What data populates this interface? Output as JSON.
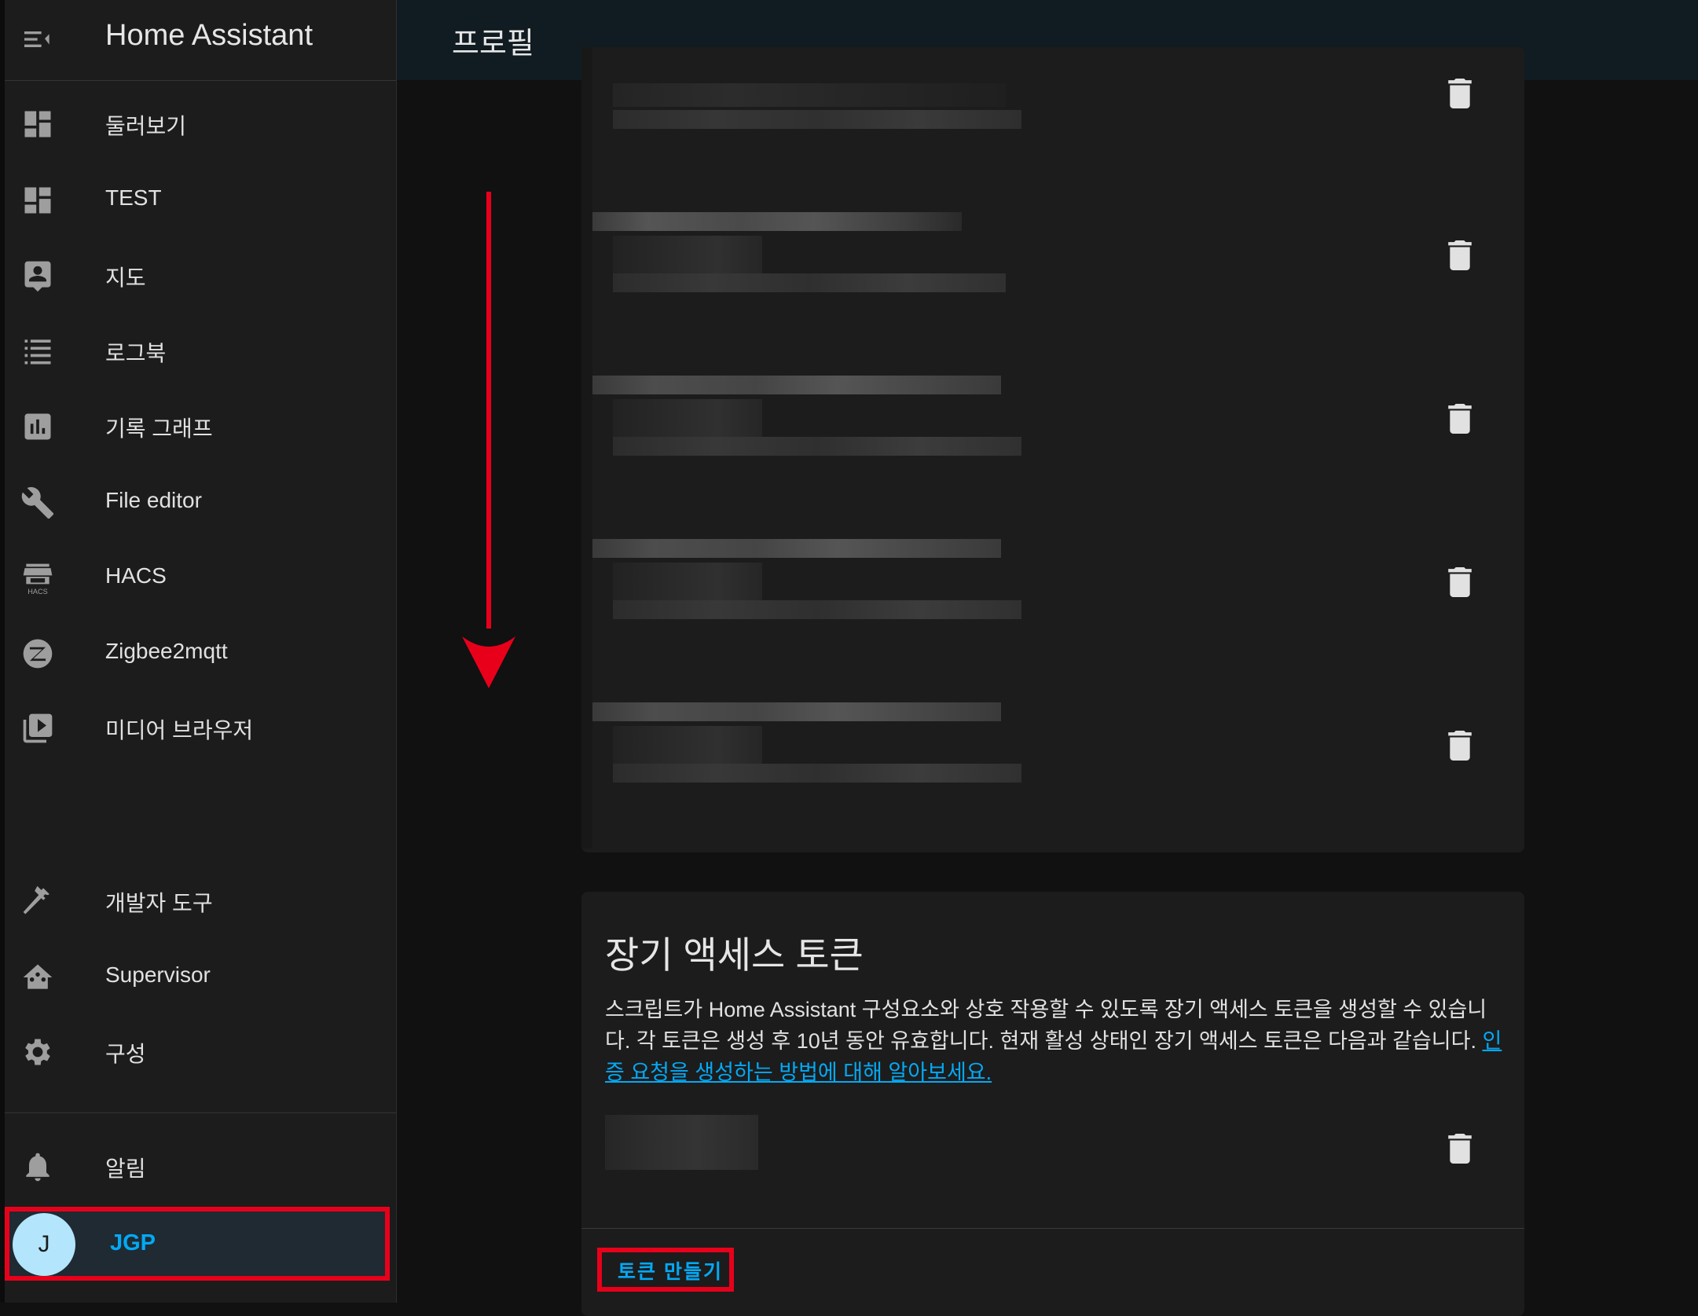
{
  "app": {
    "title": "Home Assistant"
  },
  "header": {
    "title": "프로필"
  },
  "sidebar": {
    "items": [
      {
        "label": "둘러보기",
        "icon": "dashboard-icon"
      },
      {
        "label": "TEST",
        "icon": "dashboard-icon"
      },
      {
        "label": "지도",
        "icon": "map-account-icon"
      },
      {
        "label": "로그북",
        "icon": "logbook-list-icon"
      },
      {
        "label": "기록 그래프",
        "icon": "history-chart-icon"
      },
      {
        "label": "File editor",
        "icon": "wrench-icon"
      },
      {
        "label": "HACS",
        "icon": "hacs-store-icon"
      },
      {
        "label": "Zigbee2mqtt",
        "icon": "zigbee-icon"
      },
      {
        "label": "미디어 브라우저",
        "icon": "media-play-icon"
      }
    ],
    "bottom_items": [
      {
        "label": "개발자 도구",
        "icon": "hammer-icon"
      },
      {
        "label": "Supervisor",
        "icon": "supervisor-home-icon"
      },
      {
        "label": "구성",
        "icon": "gear-icon"
      }
    ],
    "notifications": {
      "label": "알림",
      "icon": "bell-icon"
    },
    "user": {
      "initial": "J",
      "name": "JGP"
    }
  },
  "tokens_card": {
    "title": "장기 액세스 토큰",
    "description": "스크립트가 Home Assistant 구성요소와 상호 작용할 수 있도록 장기 액세스 토큰을 생성할 수 있습니다. 각 토큰은 생성 후 10년 동안 유효합니다. 현재 활성 상태인 장기 액세스 토큰은 다음과 같습니다. ",
    "link_text": "인증 요청을 생성하는 방법에 대해 알아보세요.",
    "create_button": "토큰 만들기"
  },
  "colors": {
    "accent": "#03a9f4",
    "annotation": "#e8001b",
    "sidebar_bg": "#1c1c1c",
    "header_bg": "#111c22",
    "card_bg": "#1c1c1c",
    "page_bg": "#111111"
  }
}
